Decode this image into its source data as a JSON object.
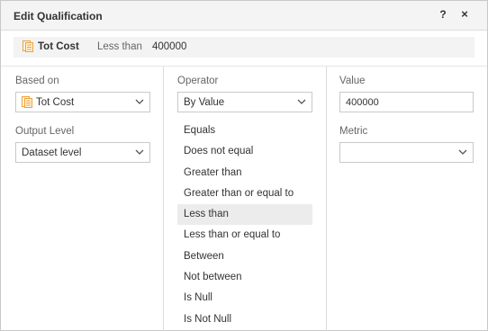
{
  "dialog": {
    "title": "Edit Qualification",
    "help_label": "?",
    "close_label": "×"
  },
  "summary": {
    "attribute": "Tot Cost",
    "operator": "Less than",
    "value": "400000"
  },
  "based_on": {
    "label": "Based on",
    "value": "Tot Cost"
  },
  "output_level": {
    "label": "Output Level",
    "value": "Dataset level"
  },
  "operator": {
    "label": "Operator",
    "value": "By Value",
    "options": [
      "Equals",
      "Does not equal",
      "Greater than",
      "Greater than or equal to",
      "Less than",
      "Less than or equal to",
      "Between",
      "Not between",
      "Is Null",
      "Is Not Null"
    ],
    "selected": "Less than"
  },
  "value_field": {
    "label": "Value",
    "value": "400000"
  },
  "metric": {
    "label": "Metric",
    "value": ""
  },
  "colors": {
    "metric_icon": "#e8a33d",
    "selected_bg": "#ececec",
    "border": "#c9c9c9"
  }
}
